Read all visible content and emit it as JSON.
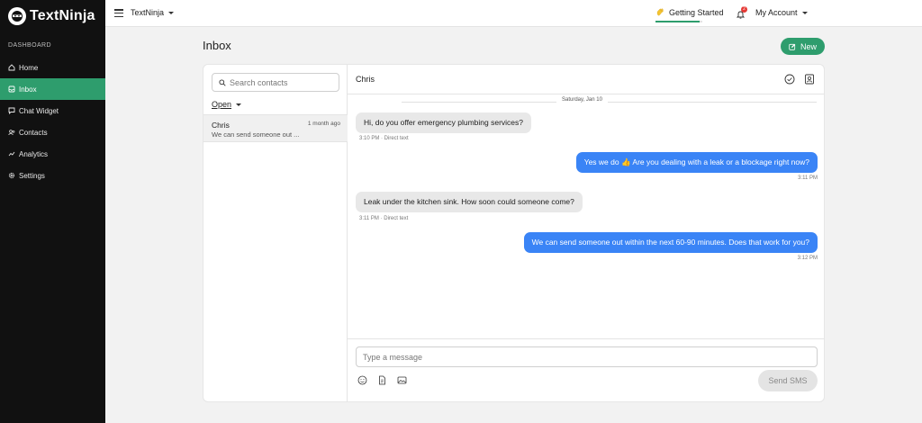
{
  "brand": {
    "name": "TextNinja",
    "logo_icon": "ninja-logo-icon"
  },
  "sidebar": {
    "section_label": "DASHBOARD",
    "items": [
      {
        "label": "Home",
        "icon": "home-icon",
        "active": false
      },
      {
        "label": "Inbox",
        "icon": "inbox-icon",
        "active": true
      },
      {
        "label": "Chat Widget",
        "icon": "chat-icon",
        "active": false
      },
      {
        "label": "Contacts",
        "icon": "contacts-icon",
        "active": false
      },
      {
        "label": "Analytics",
        "icon": "analytics-icon",
        "active": false
      },
      {
        "label": "Settings",
        "icon": "gear-icon",
        "active": false
      }
    ]
  },
  "topbar": {
    "workspace": "TextNinja",
    "getting_started": "Getting Started",
    "getting_started_progress": 0.95,
    "notification_count": "2",
    "account": "My Account"
  },
  "page": {
    "title": "Inbox",
    "new_button": "New"
  },
  "contacts": {
    "search_placeholder": "Search contacts",
    "filter": "Open",
    "list": [
      {
        "name": "Chris",
        "time": "1 month ago",
        "preview": "We can send someone out ..."
      }
    ]
  },
  "chat": {
    "contact_name": "Chris",
    "date_separator": "Saturday, Jan 10",
    "messages": [
      {
        "direction": "in",
        "text": "Hi, do you offer emergency plumbing services?",
        "meta": "3:10 PM · Direct text"
      },
      {
        "direction": "out",
        "text": "Yes we do 👍 Are you dealing with a leak or a blockage right now?",
        "meta": "3:11 PM"
      },
      {
        "direction": "in",
        "text": "Leak under the kitchen sink. How soon could someone come?",
        "meta": "3:11 PM · Direct text"
      },
      {
        "direction": "out",
        "text": "We can send someone out within the next 60-90 minutes. Does that work for you?",
        "meta": "3:12 PM"
      }
    ],
    "composer_placeholder": "Type a message",
    "send_button": "Send SMS"
  },
  "colors": {
    "accent": "#2e9d6d",
    "outgoing_bubble": "#3a84f6",
    "sidebar_bg": "#111111"
  }
}
